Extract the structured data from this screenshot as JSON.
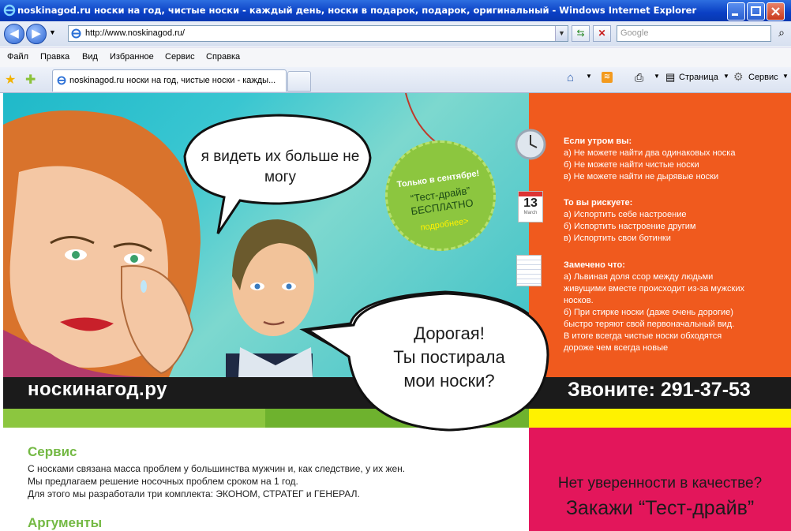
{
  "window": {
    "title": "noskinagod.ru носки на год, чистые носки - каждый день, носки в подарок, подарок, оригинальный  - Windows Internet Explorer"
  },
  "address_bar": {
    "url": "http://www.noskinagod.ru/",
    "search_placeholder": "Google"
  },
  "menu": [
    "Файл",
    "Правка",
    "Вид",
    "Избранное",
    "Сервис",
    "Справка"
  ],
  "tab": {
    "label": "noskinagod.ru носки на год, чистые носки - кажды..."
  },
  "command_bar": {
    "page_label": "Страница",
    "tools_label": "Сервис"
  },
  "hero": {
    "bubble_woman": "я видеть их больше не могу",
    "bubble_man_line1": "Дорогая!",
    "bubble_man_line2": "Ты постирала",
    "bubble_man_line3": "мои носки?",
    "tag_line1": "Только в сентябре!",
    "tag_line2": "“Тест-драйв”",
    "tag_line3": "БЕСПЛАТНО",
    "tag_more": "подробнее>"
  },
  "panel": {
    "s1_title": "Если утром вы:",
    "s1_l1": "а) Не можете найти два одинаковых носка",
    "s1_l2": "б) Не можете найти чистые носки",
    "s1_l3": "в) Не можете найти не дырявые носки",
    "s2_title": "То вы рискуете:",
    "s2_l1": "а) Испортить себе настроение",
    "s2_l2": "б) Испортить настроение другим",
    "s2_l3": "в) Испортить свои ботинки",
    "s3_title": "Замечено что:",
    "s3_l1": "а) Львиная доля ссор между людьми",
    "s3_l2": "живущими вместе происходит из-за мужских",
    "s3_l3": "носков.",
    "s3_l4": "б) При стирке носки (даже очень дорогие)",
    "s3_l5": "быстро теряют свой первоначальный вид.",
    "s3_l6": "В итоге всегда чистые носки обходятся",
    "s3_l7": "дороже чем всегда новые",
    "calendar_day": "13",
    "calendar_month": "March"
  },
  "brand": "носкинагод.ру",
  "phone": "Звоните: 291-37-53",
  "content": {
    "service_heading": "Сервис",
    "service_l1": "С носками связана масса проблем у большинства мужчин и, как следствие, у их жен.",
    "service_l2": "Мы предлагаем решение носочных проблем сроком на 1 год.",
    "service_l3": "Для этого мы разработали три комплекта: ЭКОНОМ, СТРАТЕГ и ГЕНЕРАЛ.",
    "args_heading": "Аргументы"
  },
  "promo": {
    "question": "Нет уверенности в качестве?",
    "cta": "Закажи “Тест-драйв”"
  },
  "colors": {
    "orange_panel": "#f05a1e",
    "green": "#8cc63f",
    "yellow": "#fff200",
    "pink": "#e3165b",
    "dark": "#1b1b1b",
    "teal": "#1fb9c9"
  }
}
